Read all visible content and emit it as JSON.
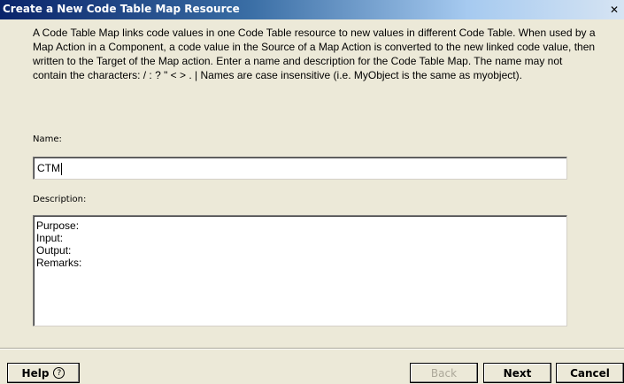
{
  "dialog": {
    "title": "Create a New Code Table Map Resource",
    "close_label": "✕",
    "intro_text": "A Code Table Map links code values in one Code Table resource to new values in different Code Table. When used by a Map Action in a Component, a code value in the Source of a Map Action is converted to the new linked code value, then written to the Target of the Map action.  Enter a name and description for the Code Table Map.  The name may not contain the characters:  / : ? \" < > . |  Names are case insensitive (i.e. MyObject is the same as myobject).",
    "name_label": "Name:",
    "name_value": "CTM",
    "description_label": "Description:",
    "description_lines": [
      "Purpose:",
      "Input:",
      "Output:",
      "Remarks:"
    ]
  },
  "buttons": {
    "help_label": "Help",
    "help_icon": "?",
    "back_label": "Back",
    "next_label": "Next",
    "cancel_label": "Cancel"
  }
}
